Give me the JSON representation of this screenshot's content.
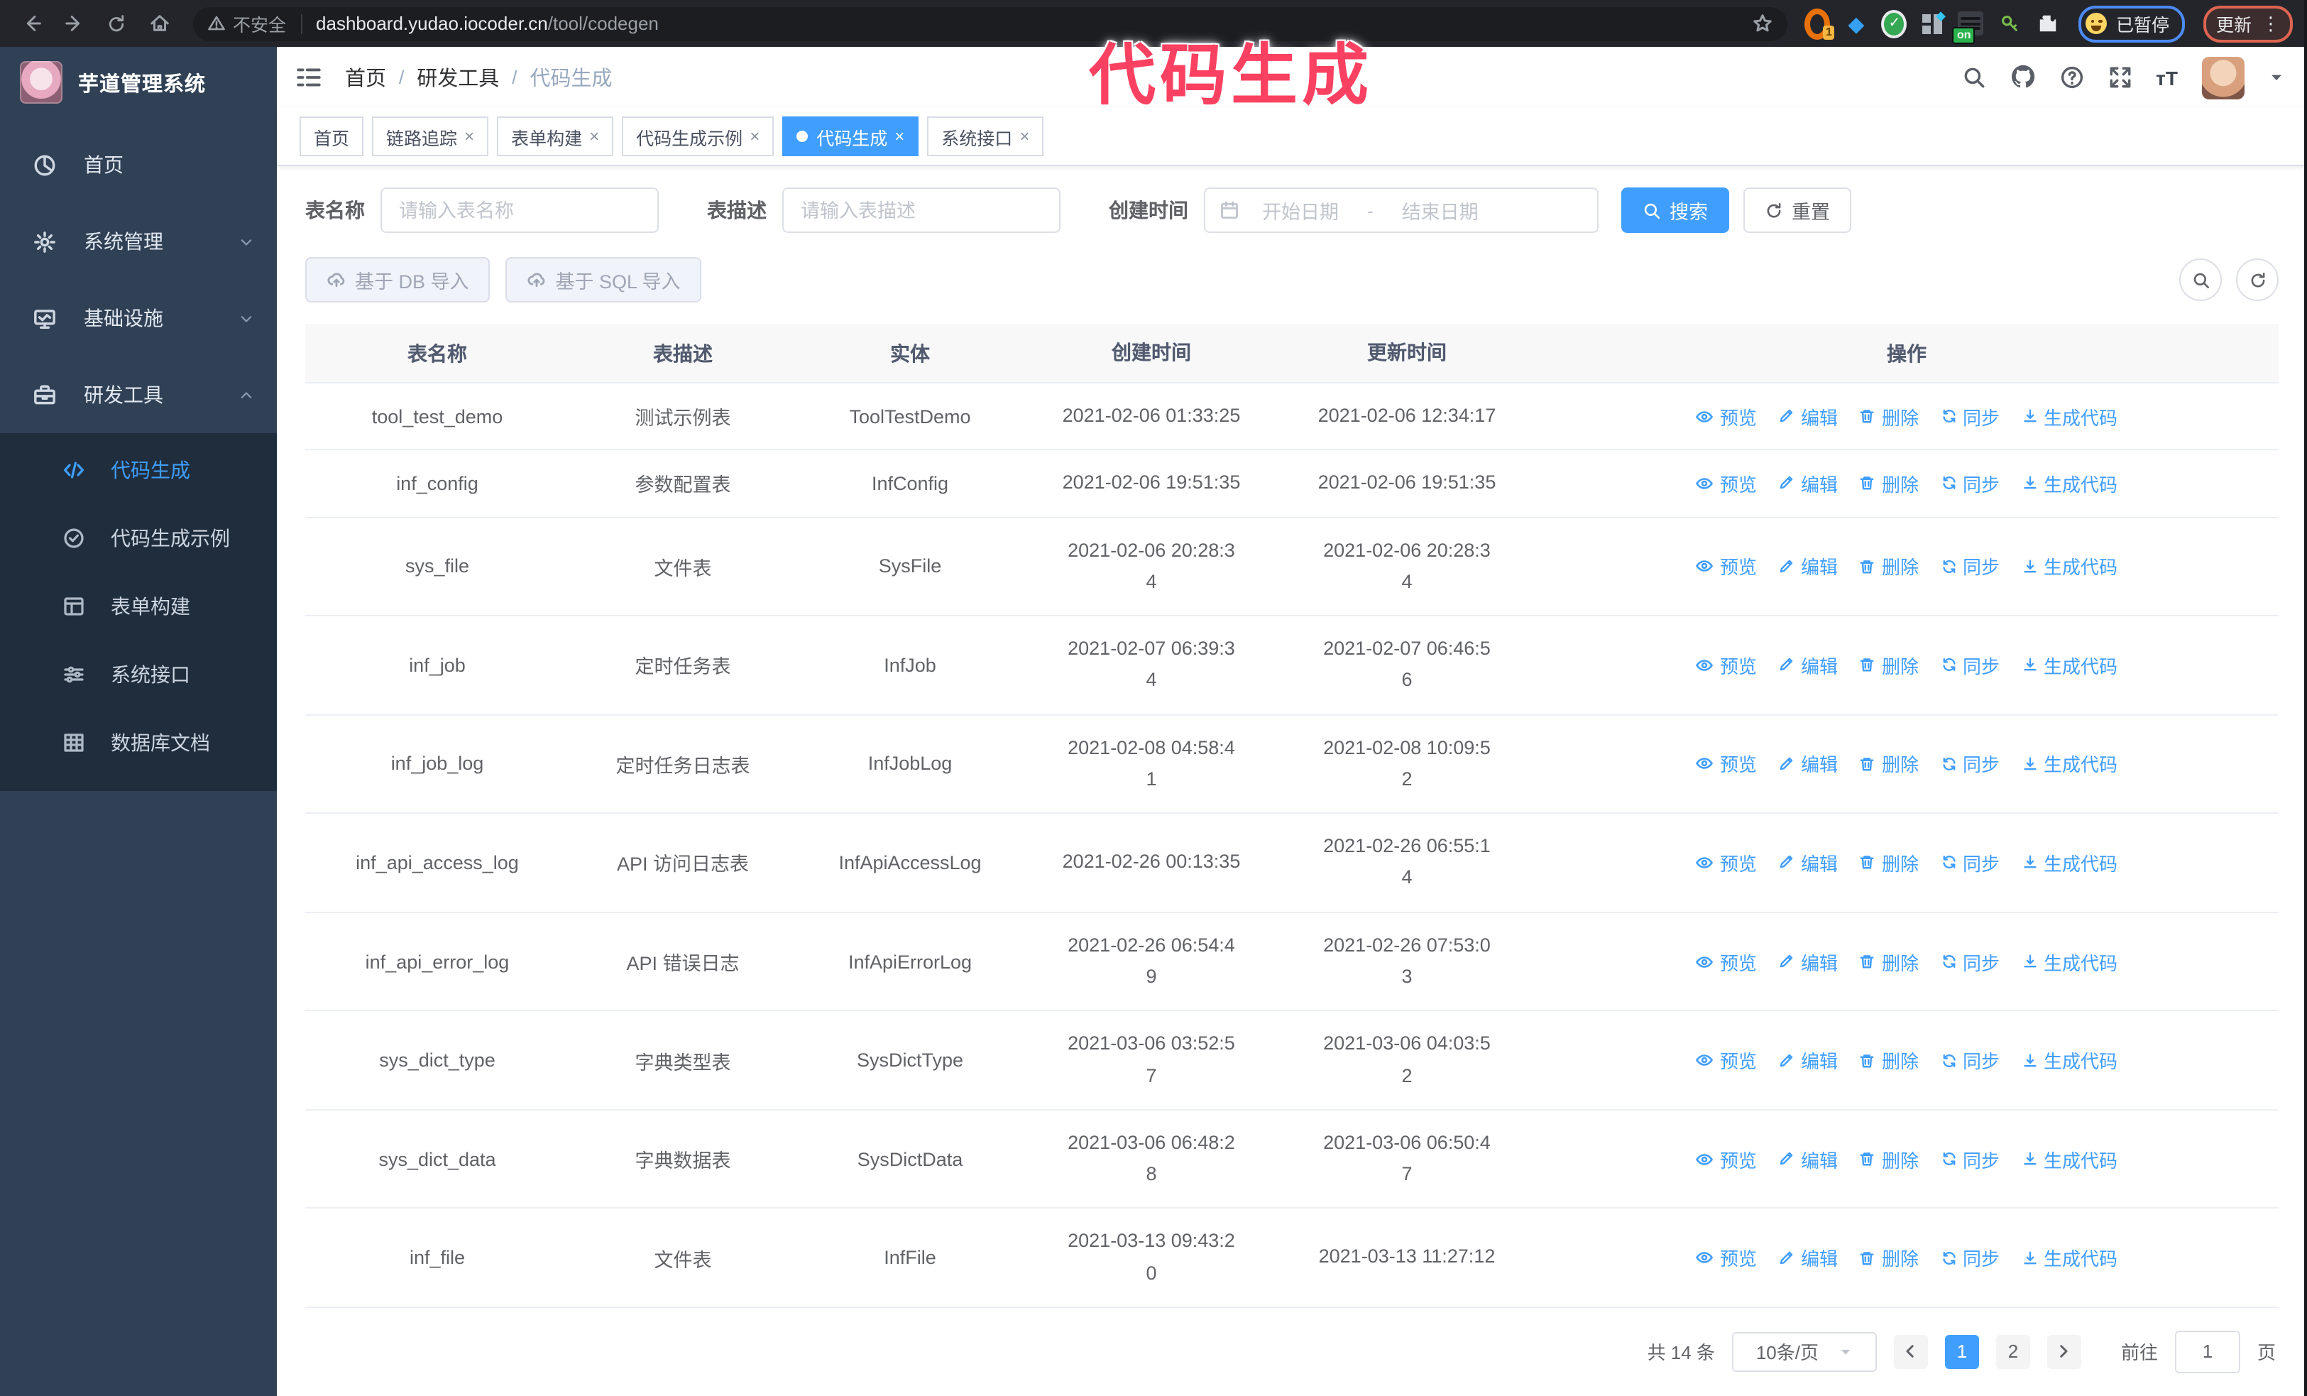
{
  "annotation": {
    "text": "代码生成",
    "color": "#fb4161"
  },
  "browser": {
    "security_label": "不安全",
    "url_host": "dashboard.yudao.iocoder.cn",
    "url_path": "/tool/codegen",
    "extension_badge_count": "1",
    "extension_badge_on": "on",
    "paused_chip": "已暂停",
    "update_button": "更新",
    "icons": [
      "back-arrow",
      "forward-arrow",
      "reload",
      "home",
      "warning-triangle",
      "bookmark-star",
      "kebab-menu"
    ]
  },
  "sidebar": {
    "app_title": "芋道管理系统",
    "items": [
      {
        "icon": "dashboard",
        "label": "首页",
        "chevron": false,
        "open": false
      },
      {
        "icon": "gear",
        "label": "系统管理",
        "chevron": true,
        "open": false
      },
      {
        "icon": "monitor",
        "label": "基础设施",
        "chevron": true,
        "open": false
      },
      {
        "icon": "toolbox",
        "label": "研发工具",
        "chevron": true,
        "open": true
      }
    ],
    "submenu": [
      {
        "icon": "code",
        "label": "代码生成",
        "active": true
      },
      {
        "icon": "example",
        "label": "代码生成示例",
        "active": false
      },
      {
        "icon": "form",
        "label": "表单构建",
        "active": false
      },
      {
        "icon": "sliders",
        "label": "系统接口",
        "active": false
      },
      {
        "icon": "dbdoc",
        "label": "数据库文档",
        "active": false
      }
    ]
  },
  "breadcrumb": {
    "separator": "/",
    "items": [
      "首页",
      "研发工具",
      "代码生成"
    ]
  },
  "header_icons": {
    "font_size_glyph": "тT"
  },
  "tabs": [
    {
      "label": "首页",
      "closable": false,
      "active": false
    },
    {
      "label": "链路追踪",
      "closable": true,
      "active": false
    },
    {
      "label": "表单构建",
      "closable": true,
      "active": false
    },
    {
      "label": "代码生成示例",
      "closable": true,
      "active": false
    },
    {
      "label": "代码生成",
      "closable": true,
      "active": true
    },
    {
      "label": "系统接口",
      "closable": true,
      "active": false
    }
  ],
  "filters": {
    "name_label": "表名称",
    "name_placeholder": "请输入表名称",
    "desc_label": "表描述",
    "desc_placeholder": "请输入表描述",
    "time_label": "创建时间",
    "start_placeholder": "开始日期",
    "range_dash": "-",
    "end_placeholder": "结束日期",
    "search_label": "搜索",
    "reset_label": "重置"
  },
  "toolbar": {
    "import_db_label": "基于 DB 导入",
    "import_sql_label": "基于 SQL 导入"
  },
  "table": {
    "headers": [
      "表名称",
      "表描述",
      "实体",
      "创建时间",
      "更新时间",
      "操作"
    ],
    "actions": [
      "预览",
      "编辑",
      "删除",
      "同步",
      "生成代码"
    ],
    "rows": [
      {
        "name": "tool_test_demo",
        "desc": "测试示例表",
        "entity": "ToolTestDemo",
        "created": "2021-02-06 01:33:25",
        "updated": "2021-02-06 12:34:17"
      },
      {
        "name": "inf_config",
        "desc": "参数配置表",
        "entity": "InfConfig",
        "created": "2021-02-06 19:51:35",
        "updated": "2021-02-06 19:51:35"
      },
      {
        "name": "sys_file",
        "desc": "文件表",
        "entity": "SysFile",
        "created": "2021-02-06 20:28:3\n4",
        "updated": "2021-02-06 20:28:3\n4"
      },
      {
        "name": "inf_job",
        "desc": "定时任务表",
        "entity": "InfJob",
        "created": "2021-02-07 06:39:3\n4",
        "updated": "2021-02-07 06:46:5\n6"
      },
      {
        "name": "inf_job_log",
        "desc": "定时任务日志表",
        "entity": "InfJobLog",
        "created": "2021-02-08 04:58:4\n1",
        "updated": "2021-02-08 10:09:5\n2"
      },
      {
        "name": "inf_api_access_log",
        "desc": "API 访问日志表",
        "entity": "InfApiAccessLog",
        "created": "2021-02-26 00:13:35",
        "updated": "2021-02-26 06:55:1\n4"
      },
      {
        "name": "inf_api_error_log",
        "desc": "API 错误日志",
        "entity": "InfApiErrorLog",
        "created": "2021-02-26 06:54:4\n9",
        "updated": "2021-02-26 07:53:0\n3"
      },
      {
        "name": "sys_dict_type",
        "desc": "字典类型表",
        "entity": "SysDictType",
        "created": "2021-03-06 03:52:5\n7",
        "updated": "2021-03-06 04:03:5\n2"
      },
      {
        "name": "sys_dict_data",
        "desc": "字典数据表",
        "entity": "SysDictData",
        "created": "2021-03-06 06:48:2\n8",
        "updated": "2021-03-06 06:50:4\n7"
      },
      {
        "name": "inf_file",
        "desc": "文件表",
        "entity": "InfFile",
        "created": "2021-03-13 09:43:2\n0",
        "updated": "2021-03-13 11:27:12"
      }
    ]
  },
  "pagination": {
    "total_label": "共 14 条",
    "page_size": "10条/页",
    "pages": [
      {
        "label": "1",
        "active": true
      },
      {
        "label": "2",
        "active": false
      }
    ],
    "goto_label": "前往",
    "goto_value": "1",
    "page_suffix": "页"
  }
}
